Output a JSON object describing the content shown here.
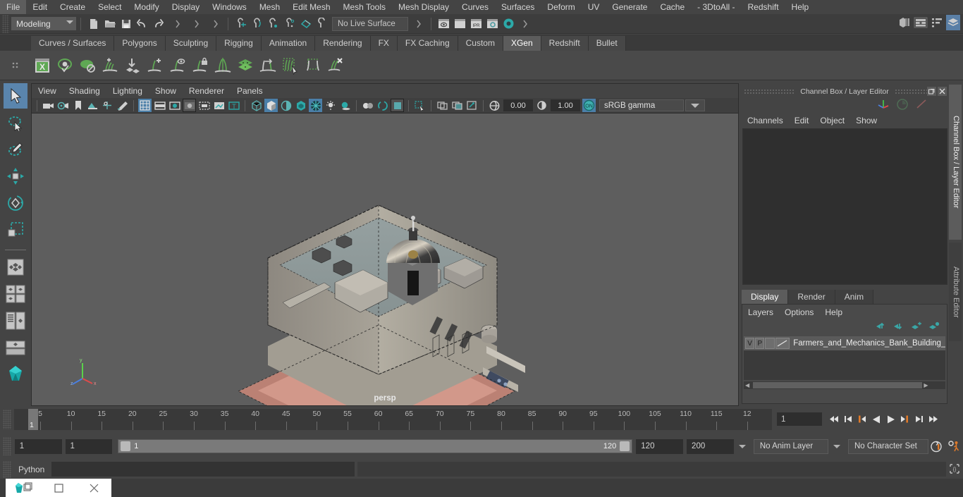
{
  "menubar": {
    "items": [
      "File",
      "Edit",
      "Create",
      "Select",
      "Modify",
      "Display",
      "Windows",
      "Mesh",
      "Edit Mesh",
      "Mesh Tools",
      "Mesh Display",
      "Curves",
      "Surfaces",
      "Deform",
      "UV",
      "Generate",
      "Cache",
      "- 3DtoAll -",
      "Redshift",
      "Help"
    ]
  },
  "statusbar": {
    "mode": "Modeling",
    "live_surface": "No Live Surface",
    "icons": [
      "new-scene-icon",
      "open-scene-icon",
      "save-scene-icon",
      "undo-icon",
      "redo-icon",
      "select-by-hierarchy-icon",
      "select-by-object-icon",
      "select-by-component-icon",
      "snap-to-grid-icon",
      "snap-to-curve-icon",
      "snap-to-point-icon",
      "snap-to-projected-center-icon",
      "snap-to-view-plane-icon",
      "make-live-icon",
      "render-current-frame-icon",
      "render-sequence-icon",
      "ipr-render-icon",
      "render-settings-icon",
      "hypershade-icon"
    ],
    "right_icons": [
      "show-hide-modeling-toolkit-icon",
      "show-hide-attribute-editor-icon",
      "show-hide-tool-settings-icon",
      "show-hide-channel-box-icon"
    ]
  },
  "shelf": {
    "tabs": [
      "Curves / Surfaces",
      "Polygons",
      "Sculpting",
      "Rigging",
      "Animation",
      "Rendering",
      "FX",
      "FX Caching",
      "Custom",
      "XGen",
      "Redshift",
      "Bullet"
    ],
    "active_tab": "XGen",
    "icons": [
      "xgen-editor-icon",
      "xgen-preview-icon",
      "xgen-preview-off-icon",
      "xgen-add-density-icon",
      "xgen-place-guide-icon",
      "xgen-add-guide-icon",
      "xgen-show-guide-icon",
      "xgen-lock-guide-icon",
      "xgen-mirror-guide-icon",
      "xgen-layers-icon",
      "xgen-convert-icon",
      "xgen-select-primitives-icon",
      "xgen-box-select-icon",
      "xgen-delete-guide-icon"
    ]
  },
  "toolbox": {
    "items": [
      "select-tool-icon",
      "lasso-select-tool-icon",
      "paint-select-tool-icon",
      "move-tool-icon",
      "rotate-tool-icon",
      "scale-tool-icon",
      "last-tool-icon",
      "single-perspective-layout-icon",
      "four-view-layout-icon",
      "persp-outliner-layout-icon",
      "outliner-persp-layout-icon",
      "hypershade-persp-layout-icon",
      "maya-logo-icon"
    ],
    "selected": "select-tool-icon"
  },
  "viewport": {
    "menus": [
      "View",
      "Shading",
      "Lighting",
      "Show",
      "Renderer",
      "Panels"
    ],
    "camera_label": "persp",
    "exposure": "0.00",
    "gamma": "1.00",
    "color_mode": "sRGB gamma",
    "color_mgmt_toggle": "ON",
    "toolbar_icons": [
      "select-camera-icon",
      "camera-attributes-icon",
      "bookmark-icon",
      "image-plane-icon",
      "two-d-pan-zoom-icon",
      "grease-pencil-icon",
      "grid-toggle-icon",
      "film-gate-icon",
      "resolution-gate-icon",
      "gate-mask-icon",
      "field-chart-icon",
      "safe-action-icon",
      "safe-title-icon",
      "wireframe-icon",
      "smooth-shade-all-icon",
      "shaded-wireframe-icon",
      "use-default-material-icon",
      "textured-icon",
      "use-all-lights-icon",
      "shadows-icon",
      "ambient-occlusion-icon",
      "motion-blur-icon",
      "multisample-icon",
      "isolate-select-icon",
      "xray-icon",
      "xray-joints-icon",
      "xray-active-components-icon",
      "exposure-icon",
      "gamma-icon"
    ],
    "axis_gizmo": {
      "x": "x",
      "y": "y",
      "z": "z"
    }
  },
  "channelbox": {
    "title": "Channel Box / Layer Editor",
    "menus": [
      "Channels",
      "Edit",
      "Object",
      "Show"
    ],
    "header_icons": [
      "channel-box-icon",
      "anim-layer-icon",
      "character-set-icon"
    ],
    "window_buttons": [
      "undock-icon",
      "close-icon"
    ]
  },
  "layer_editor": {
    "tabs": [
      "Display",
      "Render",
      "Anim"
    ],
    "active_tab": "Display",
    "menus": [
      "Layers",
      "Options",
      "Help"
    ],
    "buttons": [
      "move-layer-up-icon",
      "move-layer-down-icon",
      "create-new-layer-icon",
      "create-layer-from-selected-icon"
    ],
    "layers": [
      {
        "visibility": "V",
        "playback": "P",
        "shading": "",
        "name": "Farmers_and_Mechanics_Bank_Building_in_"
      }
    ]
  },
  "side_tabs": {
    "items": [
      "Channel Box / Layer Editor",
      "Attribute Editor"
    ],
    "active": "Channel Box / Layer Editor"
  },
  "timeslider": {
    "tick_labels": [
      "5",
      "10",
      "15",
      "20",
      "25",
      "30",
      "35",
      "40",
      "45",
      "50",
      "55",
      "60",
      "65",
      "70",
      "75",
      "80",
      "85",
      "90",
      "95",
      "100",
      "105",
      "110",
      "115",
      "12"
    ],
    "current_frame": "1",
    "current_frame_field": "1",
    "playback_buttons": [
      "go-to-start-icon",
      "step-back-frame-icon",
      "step-back-key-icon",
      "play-backwards-icon",
      "play-forwards-icon",
      "step-forward-key-icon",
      "step-forward-frame-icon",
      "go-to-end-icon"
    ]
  },
  "rangebar": {
    "anim_start": "1",
    "range_start": "1",
    "slider_left_label": "1",
    "slider_right_label": "120",
    "range_end": "120",
    "anim_end": "200",
    "anim_layer": "No Anim Layer",
    "character_set": "No Character Set",
    "icons": [
      "auto-keyframe-icon",
      "animation-preferences-icon"
    ]
  },
  "cmdline": {
    "language": "Python",
    "input_value": "",
    "script-editor-icon": "script-editor-icon"
  },
  "taskbar": {
    "buttons": [
      "maya-app-icon",
      "restore-icon",
      "maximize-icon",
      "close-icon"
    ]
  },
  "colors": {
    "accent_blue": "#5a85ad",
    "teal": "#2ca9a8",
    "xgen_green": "#6aa84f",
    "orange": "#d07a2a",
    "panel_bg": "#444444",
    "viewport_bg": "#5e5e5e"
  }
}
